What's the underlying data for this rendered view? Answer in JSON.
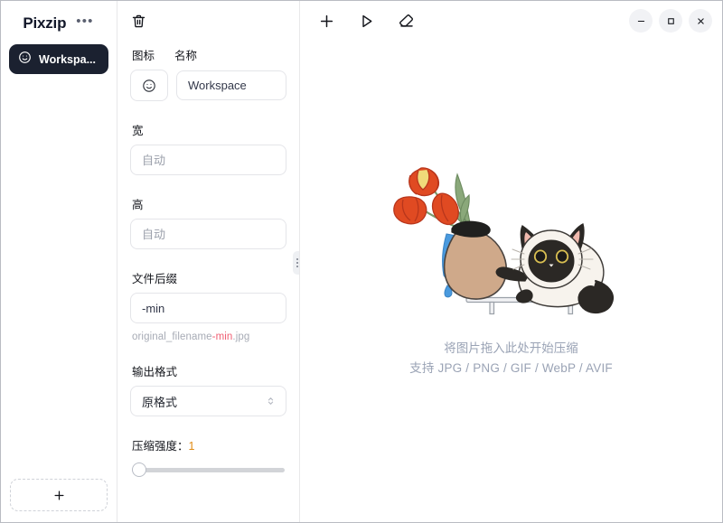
{
  "app": {
    "title": "Pixzip",
    "more_menu_label": "•••"
  },
  "sidebar": {
    "workspaces": [
      {
        "icon": "smiley-icon",
        "label": "Workspa..."
      }
    ],
    "add_workspace_label": "+"
  },
  "settings": {
    "delete_icon": "trash-icon",
    "icon_label": "图标",
    "name_label": "名称",
    "workspace_icon": "☺",
    "name_value": "Workspace",
    "name_placeholder": "Workspace",
    "width": {
      "label": "宽",
      "value": "",
      "placeholder": "自动"
    },
    "height": {
      "label": "高",
      "value": "",
      "placeholder": "自动"
    },
    "suffix": {
      "label": "文件后缀",
      "value": "-min",
      "placeholder": "-min",
      "preview_prefix": "original_filename",
      "preview_highlight": "-min",
      "preview_suffix": ".jpg"
    },
    "output_format": {
      "label": "输出格式",
      "selected": "原格式",
      "options": [
        "原格式"
      ]
    },
    "strength": {
      "label": "压缩强度：",
      "value": "1",
      "min": 1,
      "max": 10,
      "percent": 0
    },
    "resize_handle": "panel-resize-handle"
  },
  "toolbar": {
    "add_icon": "plus-icon",
    "start_icon": "play-icon",
    "clear_icon": "eraser-icon",
    "minimize_icon": "minimize-icon",
    "maximize_icon": "maximize-icon",
    "close_icon": "close-icon"
  },
  "dropzone": {
    "illustration": "cat-and-vase-illustration",
    "line1": "将图片拖入此处开始压缩",
    "line2": "支持 JPG / PNG / GIF / WebP / AVIF"
  },
  "colors": {
    "accent_dark": "#1b2130",
    "highlight_red": "#ef5e72",
    "strength_number": "#e08a13",
    "muted_text": "#9aa3b5",
    "border": "#e4e5e9"
  }
}
